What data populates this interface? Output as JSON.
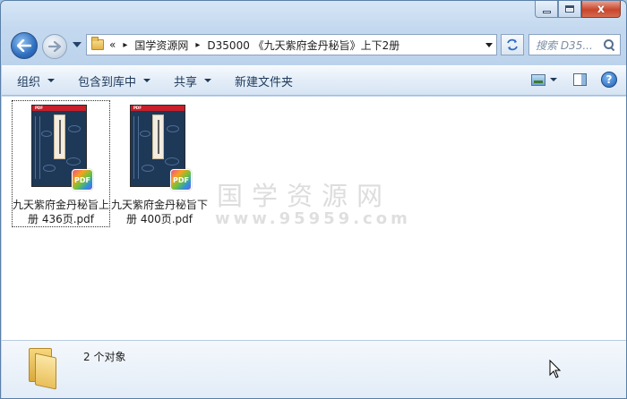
{
  "window": {
    "caption_close": "x"
  },
  "address": {
    "overflow": "«",
    "crumbs": [
      "国学资源网",
      "D35000 《九天紫府金丹秘旨》上下2册"
    ],
    "separator": "▸"
  },
  "search": {
    "placeholder": "搜索 D35..."
  },
  "toolbar": {
    "organize": "组织",
    "include_library": "包含到库中",
    "share": "共享",
    "new_folder": "新建文件夹",
    "help": "?"
  },
  "files": [
    {
      "name": "九天紫府金丹秘旨上册 436页.pdf",
      "badge": "PDF",
      "cover_tag": "PDF",
      "selected": true
    },
    {
      "name": "九天紫府金丹秘旨下册 400页.pdf",
      "badge": "PDF",
      "cover_tag": "PDF",
      "selected": false
    }
  ],
  "watermark": {
    "title": "国学资源网",
    "url": "www.95959.com"
  },
  "details": {
    "count": "2 个对象"
  },
  "colors": {
    "cover_blue": "#1e3858",
    "cover_red": "#c81f2a",
    "toolbar_text": "#1e395b"
  }
}
